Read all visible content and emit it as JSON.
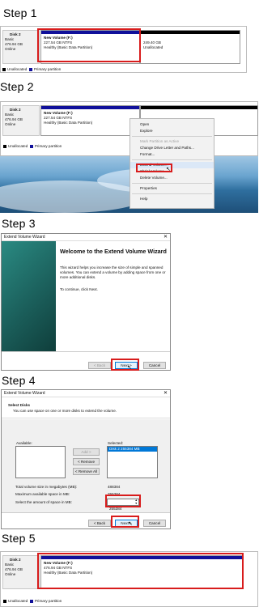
{
  "steps": [
    "Step 1",
    "Step 2",
    "Step 3",
    "Step 4",
    "Step 5"
  ],
  "disk": {
    "name": "Disk 2",
    "type": "Basic",
    "size": "476.94 GB",
    "status": "Online"
  },
  "volume": {
    "name": "New Volume  (F:)",
    "size_before": "227.54 GB NTFS",
    "size_after": "476.94 GB NTFS",
    "health": "Healthy (Basic Data Partition)"
  },
  "unallocated_part": {
    "size": "249.40 GB",
    "label": "Unallocated"
  },
  "legend": {
    "unallocated": "Unallocated",
    "primary": "Primary partition"
  },
  "context_menu": {
    "items": [
      "Open",
      "Explore",
      "Mark Partition as Active",
      "Change Drive Letter and Paths...",
      "Format...",
      "Extend Volume...",
      "Shrink Volume...",
      "Delete Volume...",
      "Properties",
      "Help"
    ]
  },
  "wizard_welcome": {
    "window_title": "Extend Volume Wizard",
    "heading": "Welcome to the Extend Volume Wizard",
    "body": "This wizard helps you increase the size of simple and spanned volumes. You can extend a volume  by adding space from one or more additional disks.",
    "continue_text": "To continue, click Next.",
    "back_label": "< Back",
    "next_label": "Next >",
    "cancel_label": "Cancel"
  },
  "wizard_select": {
    "window_title": "Extend Volume Wizard",
    "section_title": "Select Disks",
    "section_subtitle": "You can use space on one or more disks to extend the volume.",
    "available_label": "Available:",
    "selected_label": "Selected:",
    "add_label": "Add >",
    "remove_label": "< Remove",
    "remove_all_label": "< Remove All",
    "selected_item": "Disk 2    255384 MB",
    "total_label": "Total volume size in megabytes (MB):",
    "total_value": "488384",
    "max_label": "Maximum available space in MB:",
    "max_value": "255384",
    "amount_label": "Select the amount of space in MB:",
    "amount_value": "255384",
    "back_label": "< Back",
    "next_label": "Next >",
    "cancel_label": "Cancel"
  },
  "colors": {
    "primary_partition": "#10109a",
    "unallocated": "#000000",
    "highlight": "#d81c1c",
    "wizard_side": "#1e6e6a"
  }
}
